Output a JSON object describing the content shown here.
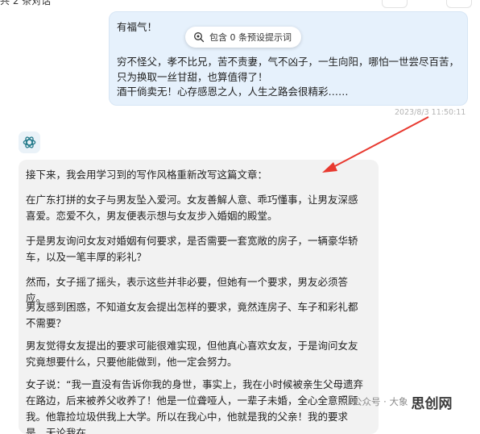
{
  "header": {
    "conversation_count": "共 2 条对话"
  },
  "user_message": {
    "lines": [
      "有福气！",
      "穷不怪父，孝不比兄，苦不责妻，气不凶子，一生向阳，哪怕一世尝尽百苦，只为换取一丝甘甜，也算值得了！",
      "酒干倘卖无！心存感恩之人，人生之路会很精彩……"
    ],
    "prompt_pill": "包含 0 条预设提示词",
    "timestamp": "2023/8/3 11:50:11"
  },
  "assistant": {
    "avatar_icon": "openai-logo-icon",
    "paragraphs": [
      "接下来，我会用学习到的写作风格重新改写这篇文章：",
      "在广东打拼的女子与男友坠入爱河。女友善解人意、乖巧懂事，让男友深感喜爱。恋爱不久，男友便表示想与女友步入婚姻的殿堂。",
      "于是男友询问女友对婚姻有何要求，是否需要一套宽敞的房子，一辆豪华轿车，以及一笔丰厚的彩礼？",
      "然而，女子摇了摇头，表示这些并非必要，但她有一个要求，男友必须答应。",
      "男友感到困惑，不知道女友会提出怎样的要求，竟然连房子、车子和彩礼都不需要？",
      "男友觉得女友提出的要求可能很难实现，但他真心喜欢女友，于是询问女友究竟想要什么，只要他能做到，他一定会努力。",
      "女子说：“我一直没有告诉你我的身世，事实上，我在小时候被亲生父母遗弃在路边，后来被养父收养了！他是一位聋哑人，一辈子未婚，全心全意照顾我。他靠捡垃圾供我上大学。所以在我心中，他就是我的父亲！我的要求是，无论我在"
    ]
  },
  "watermark": {
    "text": "公众号 · 大象",
    "brand": "思创网"
  },
  "colors": {
    "user_bubble": "#e6f1fc",
    "assistant_bubble": "#f2f2f2",
    "arrow": "#e8392f"
  }
}
